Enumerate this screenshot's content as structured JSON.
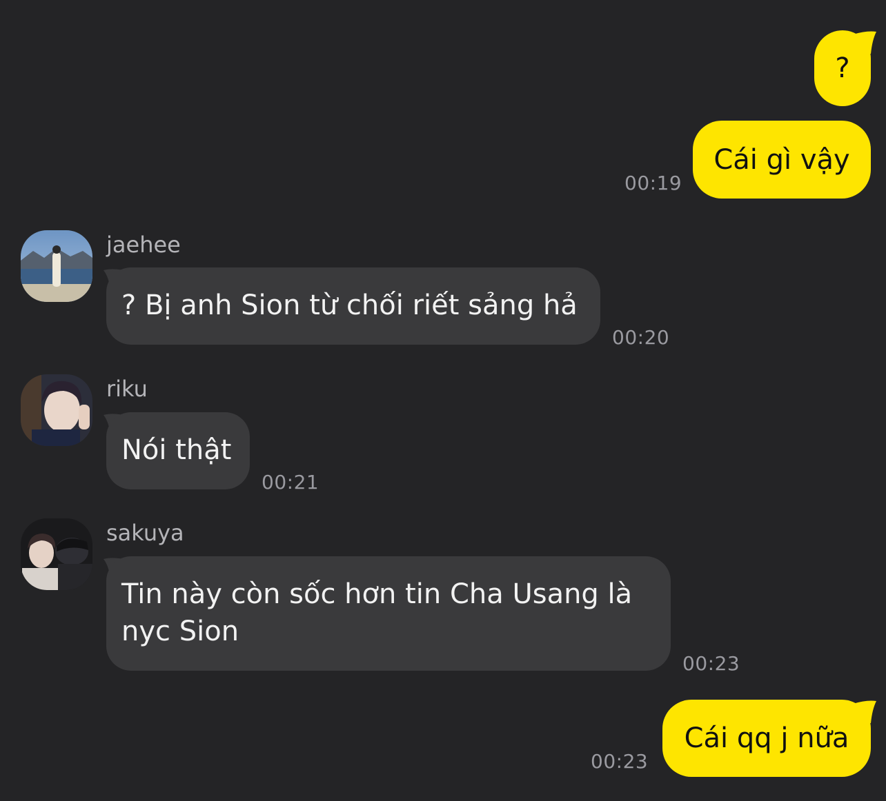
{
  "colors": {
    "background": "#242426",
    "outgoing_bubble": "#FEE500",
    "incoming_bubble": "#3A3A3C",
    "timestamp": "#9A9AA0"
  },
  "messages": [
    {
      "direction": "outgoing",
      "text": "?",
      "time": ""
    },
    {
      "direction": "outgoing",
      "text": "Cái gì vậy",
      "time": "00:19"
    },
    {
      "direction": "incoming",
      "sender": "jaehee",
      "avatar_icon": "avatar-photo-lake",
      "text": "? Bị anh Sion từ chối riết sảng hả",
      "time": "00:20"
    },
    {
      "direction": "incoming",
      "sender": "riku",
      "avatar_icon": "avatar-photo-selfie",
      "text": "Nói thật",
      "time": "00:21"
    },
    {
      "direction": "incoming",
      "sender": "sakuya",
      "avatar_icon": "avatar-photo-dark",
      "text_line1": "Tin này còn sốc hơn tin Cha Usang là",
      "text_line2": "nyc Sion",
      "time": "00:23"
    },
    {
      "direction": "outgoing",
      "text": "Cái qq j nữa",
      "time": "00:23"
    }
  ]
}
